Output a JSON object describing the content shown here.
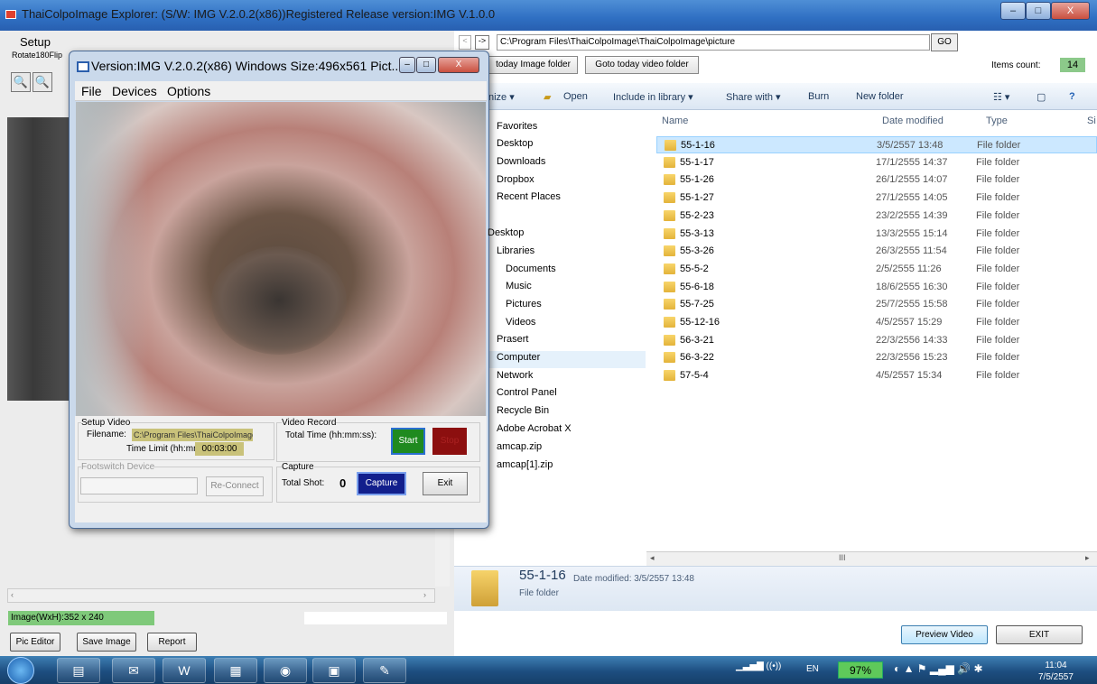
{
  "main_window": {
    "title": "ThaiColpoImage Explorer: (S/W: IMG V.2.0.2(x86))Registered Release version:IMG V.1.0.0",
    "minimize": "–",
    "maximize": "□",
    "close": "X"
  },
  "left_panel": {
    "setup_menu": "Setup",
    "rotate_label": "Rotate180Flip",
    "zoom_out": "🔍",
    "zoom_in": "🔍",
    "image_size": "Image(WxH):352 x 240",
    "scroll_left": "‹",
    "scroll_right": "›",
    "buttons": {
      "pic_editor": "Pic Editor",
      "save_image": "Save Image",
      "report": "Report"
    }
  },
  "explorer": {
    "address": "C:\\Program Files\\ThaiColpoImage\\ThaiColpoImage\\picture",
    "nav_back": "<",
    "nav_forward": "->",
    "go_button": "GO",
    "goto_today_image": "today Image folder",
    "goto_today_video": "Goto today video folder",
    "items_count_label": "Items count:",
    "items_count": "14",
    "toolbar": {
      "organize": "nize ▾",
      "open": "Open",
      "include_library": "Include in library ▾",
      "share_with": "Share with ▾",
      "burn": "Burn",
      "new_folder": "New folder"
    },
    "nav_pane": [
      "Favorites",
      "Desktop",
      "Downloads",
      "Dropbox",
      "Recent Places",
      "Desktop",
      "Libraries",
      "Documents",
      "Music",
      "Pictures",
      "Videos",
      "Prasert",
      "Computer",
      "Network",
      "Control Panel",
      "Recycle Bin",
      "Adobe Acrobat X",
      "amcap.zip",
      "amcap[1].zip"
    ],
    "columns": {
      "name": "Name",
      "date_modified": "Date modified",
      "type": "Type",
      "size": "Si"
    },
    "files": [
      {
        "name": "55-1-16",
        "date": "3/5/2557 13:48",
        "type": "File folder"
      },
      {
        "name": "55-1-17",
        "date": "17/1/2555 14:37",
        "type": "File folder"
      },
      {
        "name": "55-1-26",
        "date": "26/1/2555 14:07",
        "type": "File folder"
      },
      {
        "name": "55-1-27",
        "date": "27/1/2555 14:05",
        "type": "File folder"
      },
      {
        "name": "55-2-23",
        "date": "23/2/2555 14:39",
        "type": "File folder"
      },
      {
        "name": "55-3-13",
        "date": "13/3/2555 15:14",
        "type": "File folder"
      },
      {
        "name": "55-3-26",
        "date": "26/3/2555 11:54",
        "type": "File folder"
      },
      {
        "name": "55-5-2",
        "date": "2/5/2555 11:26",
        "type": "File folder"
      },
      {
        "name": "55-6-18",
        "date": "18/6/2555 16:30",
        "type": "File folder"
      },
      {
        "name": "55-7-25",
        "date": "25/7/2555 15:58",
        "type": "File folder"
      },
      {
        "name": "55-12-16",
        "date": "4/5/2557 15:29",
        "type": "File folder"
      },
      {
        "name": "56-3-21",
        "date": "22/3/2556 14:33",
        "type": "File folder"
      },
      {
        "name": "56-3-22",
        "date": "22/3/2556 15:23",
        "type": "File folder"
      },
      {
        "name": "57-5-4",
        "date": "4/5/2557 15:34",
        "type": "File folder"
      }
    ],
    "hscroll_thumb": "III",
    "details": {
      "name": "55-1-16",
      "modified": "Date modified: 3/5/2557 13:48",
      "type": "File folder"
    },
    "preview_video": "Preview Video",
    "exit": "EXIT"
  },
  "video_window": {
    "title": "Version:IMG V.2.0.2(x86) Windows Size:496x561 Pict...",
    "menu": {
      "file": "File",
      "devices": "Devices",
      "options": "Options"
    },
    "setup_video": "Setup Video",
    "filename_label": "Filename:",
    "filename": "C:\\Program Files\\ThaiColpoImage",
    "time_limit_label": "Time Limit (hh:mm:ss):",
    "time_limit": "00:03:00",
    "video_record": "Video Record",
    "total_time_label": "Total Time (hh:mm:ss):",
    "start": "Start",
    "stop": "Stop",
    "footswitch": "Footswitch Device",
    "reconnect": "Re-Connect",
    "capture_group": "Capture",
    "total_shot_label": "Total Shot:",
    "total_shot": "0",
    "capture": "Capture",
    "exit": "Exit"
  },
  "taskbar": {
    "lang": "EN",
    "battery": "97%",
    "time": "11:04",
    "date": "7/5/2557"
  },
  "colors": {
    "taskbar": "#1d4e80",
    "accent_green": "#7fc97a",
    "filename_field": "#c9c27a"
  }
}
